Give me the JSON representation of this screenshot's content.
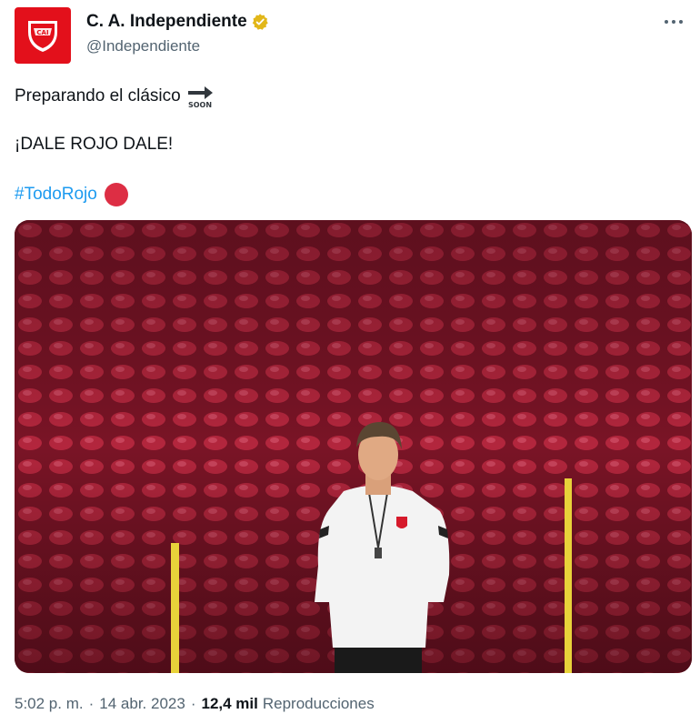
{
  "author": {
    "display_name": "C. A. Independiente",
    "handle": "@Independiente",
    "verified_icon": "verified-badge-gold",
    "avatar_color": "#e3101b"
  },
  "tweet": {
    "line1": "Preparando el clásico",
    "line1_emoji": "soon-arrow-emoji",
    "line2": "¡DALE ROJO DALE!",
    "hashtag": "#TodoRojo",
    "hashtag_emoji": "red-circle-emoji",
    "hashtag_color": "#1d9bf0"
  },
  "media": {
    "type": "photo",
    "subject": "coach-in-white-jacket-stadium-red-seats"
  },
  "meta": {
    "time": "5:02 p. m.",
    "date": "14 abr. 2023",
    "views_count": "12,4 mil",
    "views_label": "Reproducciones"
  }
}
